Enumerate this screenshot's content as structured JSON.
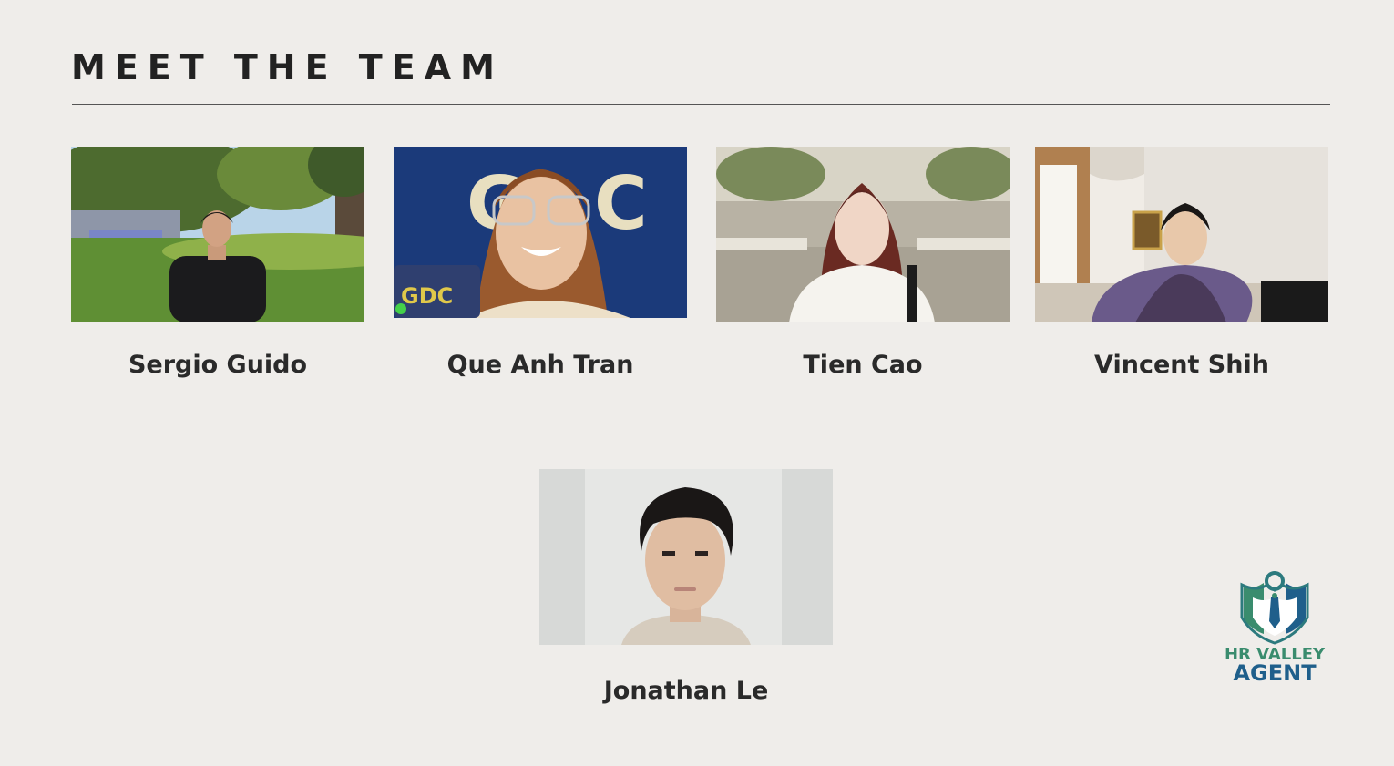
{
  "title": "MEET THE TEAM",
  "members": [
    {
      "name": "Sergio Guido"
    },
    {
      "name": "Que Anh Tran"
    },
    {
      "name": "Tien Cao"
    },
    {
      "name": "Vincent Shih"
    },
    {
      "name": "Jonathan Le"
    }
  ],
  "logo": {
    "line1": "HR VALLEY",
    "line2": "AGENT",
    "colors": {
      "green": "#3a8c6e",
      "blue": "#1f5f8b"
    }
  },
  "colors": {
    "background": "#efedea",
    "title": "#222222",
    "name": "#2a2a2a",
    "rule": "#555555"
  }
}
